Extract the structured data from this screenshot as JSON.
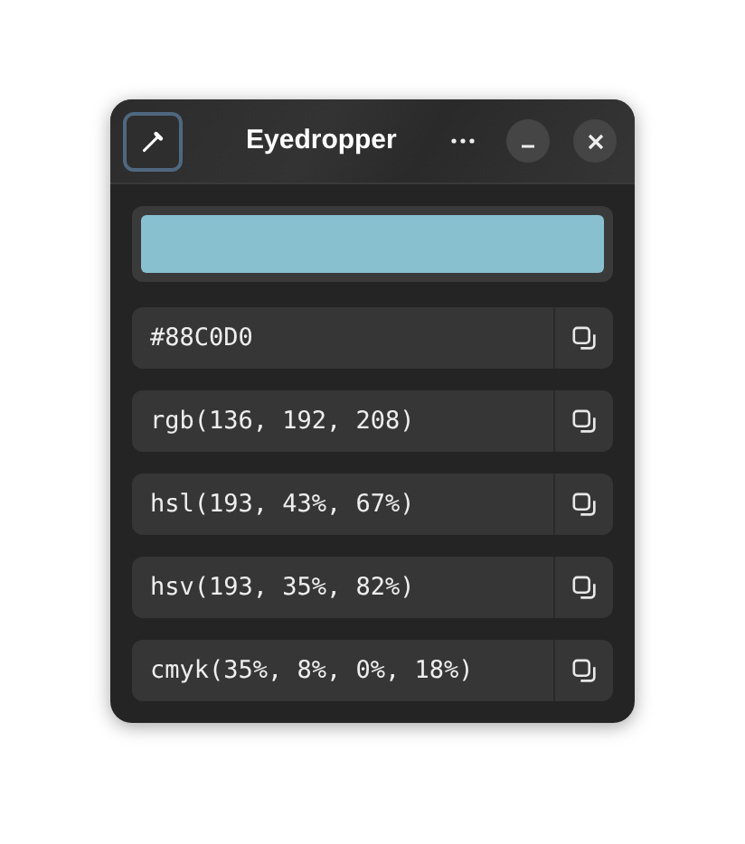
{
  "window": {
    "title": "Eyedropper"
  },
  "swatch": {
    "color": "#88c0d0"
  },
  "formats": [
    {
      "value": "#88C0D0"
    },
    {
      "value": "rgb(136, 192, 208)"
    },
    {
      "value": "hsl(193, 43%, 67%)"
    },
    {
      "value": "hsv(193, 35%, 82%)"
    },
    {
      "value": "cmyk(35%, 8%, 0%, 18%)"
    }
  ]
}
